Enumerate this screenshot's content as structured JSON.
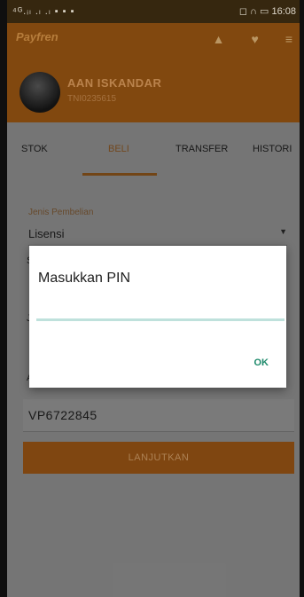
{
  "status_bar": {
    "left": "⁴ᴳ.ᵢₗ .ₗ .ₗ ▪ ▪ ▪",
    "right": "◻ ∩ ▭ 16:08"
  },
  "app": {
    "brand": "Payfren",
    "icons": [
      "bell-icon",
      "heart-icon",
      "menu-icon"
    ]
  },
  "user": {
    "name": "AAN ISKANDAR",
    "id": "TNI0235615"
  },
  "tabs": [
    {
      "label": "STOK",
      "active": false
    },
    {
      "label": "BELI",
      "active": true
    },
    {
      "label": "TRANSFER",
      "active": false
    },
    {
      "label": "HISTORI",
      "active": false
    }
  ],
  "form": {
    "section_label": "Jenis Pembelian",
    "product_value": "Lisensi",
    "field_value": "VP6722845",
    "submit": "LANJUTKAN"
  },
  "dialog": {
    "title": "Masukkan PIN",
    "pin_value": "",
    "ok": "OK"
  },
  "colors": {
    "appbar": "#8a4d10",
    "accent_teal": "#1e8a6b"
  }
}
